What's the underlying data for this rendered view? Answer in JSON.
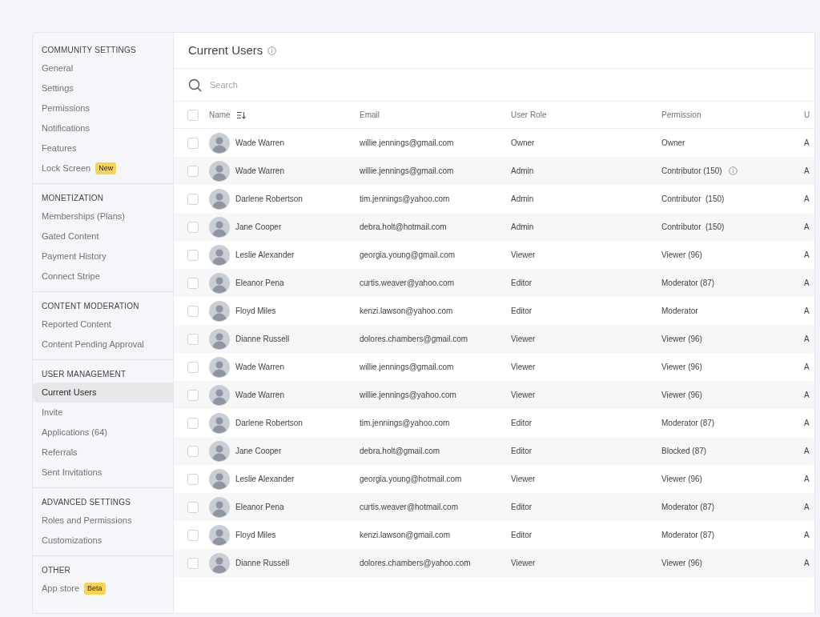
{
  "sidebar": {
    "sections": [
      {
        "title": "COMMUNITY SETTINGS",
        "items": [
          {
            "label": "General",
            "selected": false
          },
          {
            "label": "Settings",
            "selected": false
          },
          {
            "label": "Permissions",
            "selected": false
          },
          {
            "label": "Notifications",
            "selected": false
          },
          {
            "label": "Features",
            "selected": false
          },
          {
            "label": "Lock Screen",
            "badge": "New",
            "selected": false
          }
        ]
      },
      {
        "title": "MONETIZATION",
        "items": [
          {
            "label": "Memberships (Plans)",
            "selected": false
          },
          {
            "label": "Gated Content",
            "selected": false
          },
          {
            "label": "Payment History",
            "selected": false
          },
          {
            "label": "Connect Stripe",
            "selected": false
          }
        ]
      },
      {
        "title": "CONTENT MODERATION",
        "items": [
          {
            "label": "Reported Content",
            "selected": false
          },
          {
            "label": "Content Pending Approval",
            "selected": false
          }
        ]
      },
      {
        "title": "USER MANAGEMENT",
        "items": [
          {
            "label": "Current Users",
            "selected": true
          },
          {
            "label": "Invite",
            "selected": false
          },
          {
            "label": "Applications (64)",
            "selected": false
          },
          {
            "label": "Referrals",
            "selected": false
          },
          {
            "label": "Sent Invitations",
            "selected": false
          }
        ]
      },
      {
        "title": "ADVANCED SETTINGS",
        "items": [
          {
            "label": "Roles and Permissions",
            "selected": false
          },
          {
            "label": "Customizations",
            "selected": false
          }
        ]
      },
      {
        "title": "OTHER",
        "items": [
          {
            "label": "App store",
            "badge": "Beta",
            "selected": false
          }
        ]
      }
    ]
  },
  "main": {
    "title": "Current Users",
    "search": {
      "placeholder": "Search"
    },
    "table": {
      "select_all_checked": false,
      "columns": [
        "Name",
        "Email",
        "User Role",
        "Permission",
        "U"
      ],
      "rows": [
        {
          "checked": false,
          "name": "Wade Warren",
          "email": "willie.jennings@gmail.com",
          "role": "Owner",
          "permission": "Owner",
          "info": false,
          "column_5": "A"
        },
        {
          "checked": false,
          "name": "Wade Warren",
          "email": "willie.jennings@gmail.com",
          "role": "Admin",
          "permission": "Contributor (150)",
          "info": true,
          "column_5": "A"
        },
        {
          "checked": false,
          "name": "Darlene Robertson",
          "email": "tim.jennings@yahoo.com",
          "role": "Admin",
          "permission": "Contributor  (150)",
          "info": false,
          "column_5": "A"
        },
        {
          "checked": false,
          "name": "Jane Cooper",
          "email": "debra.holt@hotmail.com",
          "role": "Admin",
          "permission": "Contributor  (150)",
          "info": false,
          "column_5": "A"
        },
        {
          "checked": false,
          "name": "Leslie Alexander",
          "email": "georgia.young@gmail.com",
          "role": "Viewer",
          "permission": "Viewer (96)",
          "info": false,
          "column_5": "A"
        },
        {
          "checked": false,
          "name": "Eleanor Pena",
          "email": "curtis.weaver@yahoo.com",
          "role": "Editor",
          "permission": "Moderator (87)",
          "info": false,
          "column_5": "A"
        },
        {
          "checked": false,
          "name": "Floyd Miles",
          "email": "kenzi.lawson@yahoo.com",
          "role": "Editor",
          "permission": "Moderator",
          "info": false,
          "column_5": "A"
        },
        {
          "checked": false,
          "name": "Dianne Russell",
          "email": "dolores.chambers@gmail.com",
          "role": "Viewer",
          "permission": "Viewer (96)",
          "info": false,
          "column_5": "A"
        },
        {
          "checked": false,
          "name": "Wade Warren",
          "email": "willie.jennings@gmail.com",
          "role": "Viewer",
          "permission": "Viewer (96)",
          "info": false,
          "column_5": "A"
        },
        {
          "checked": false,
          "name": "Wade Warren",
          "email": "willie.jennings@yahoo.com",
          "role": "Viewer",
          "permission": "Viewer (96)",
          "info": false,
          "column_5": "A"
        },
        {
          "checked": false,
          "name": "Darlene Robertson",
          "email": "tim.jennings@yahoo.com",
          "role": "Editor",
          "permission": "Moderator (87)",
          "info": false,
          "column_5": "A"
        },
        {
          "checked": false,
          "name": "Jane Cooper",
          "email": "debra.holt@gmail.com",
          "role": "Editor",
          "permission": "Blocked (87)",
          "info": false,
          "column_5": "A"
        },
        {
          "checked": false,
          "name": "Leslie Alexander",
          "email": "georgia.young@hotmail.com",
          "role": "Viewer",
          "permission": "Viewer (96)",
          "info": false,
          "column_5": "A"
        },
        {
          "checked": false,
          "name": "Eleanor Pena",
          "email": "curtis.weaver@hotmail.com",
          "role": "Editor",
          "permission": "Moderator (87)",
          "info": false,
          "column_5": "A"
        },
        {
          "checked": false,
          "name": "Floyd Miles",
          "email": "kenzi.lawson@gmail.com",
          "role": "Editor",
          "permission": "Moderator (87)",
          "info": false,
          "column_5": "A"
        },
        {
          "checked": false,
          "name": "Dianne Russell",
          "email": "dolores.chambers@yahoo.com",
          "role": "Viewer",
          "permission": "Viewer (96)",
          "info": false,
          "column_5": "A"
        }
      ]
    }
  }
}
